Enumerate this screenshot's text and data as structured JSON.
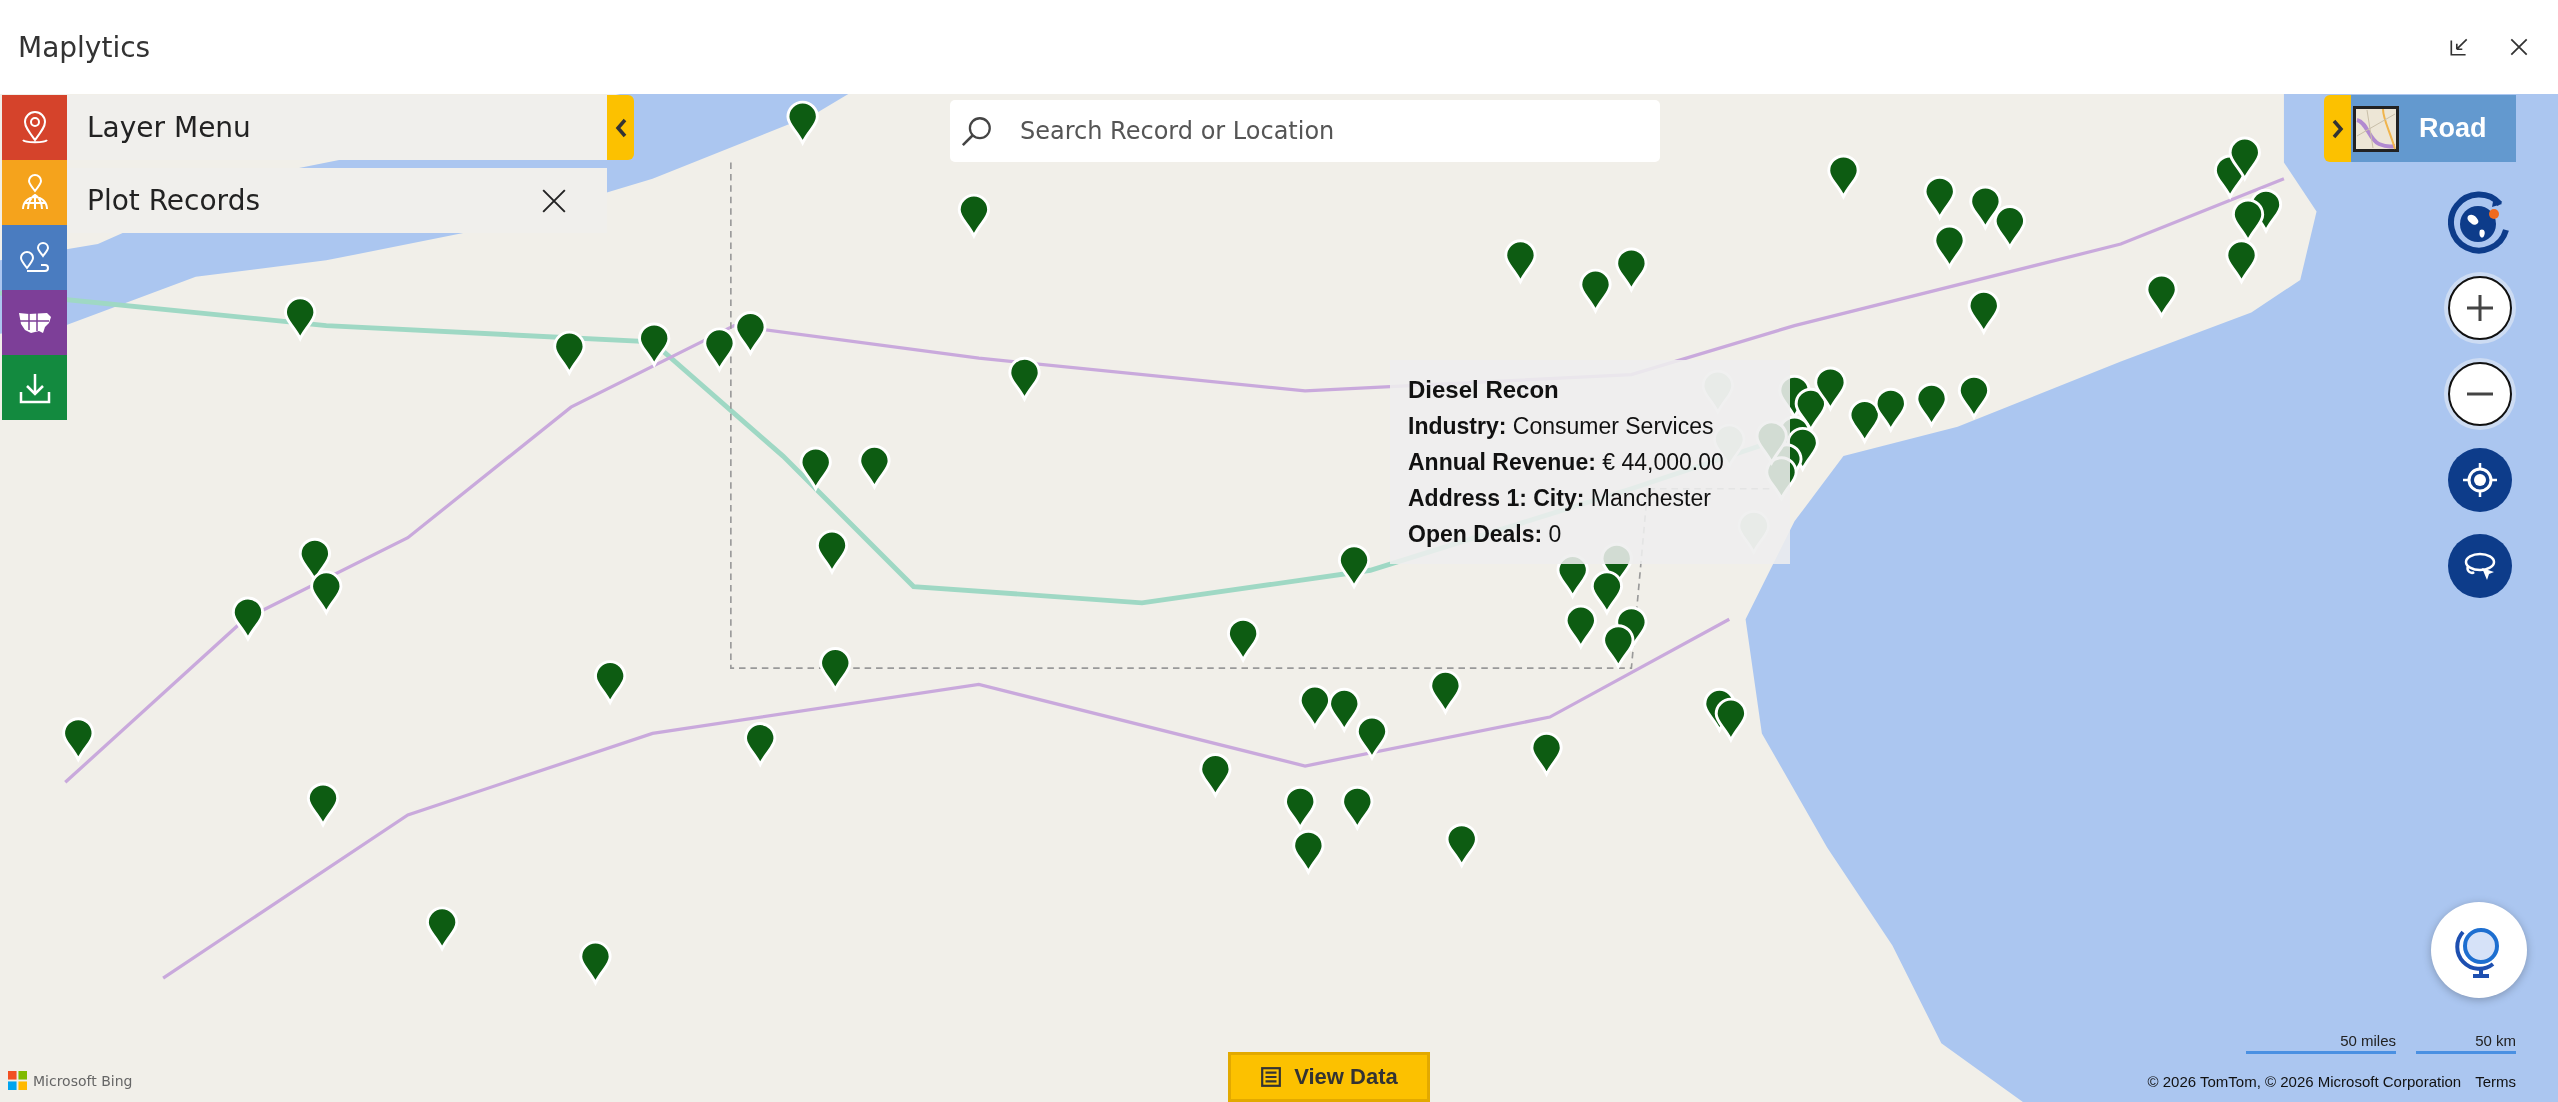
{
  "window": {
    "title": "Maplytics"
  },
  "side_menu": {
    "items": [
      {
        "kind": "layer",
        "color": "#d5432b"
      },
      {
        "kind": "plot",
        "color": "#f5a31c"
      },
      {
        "kind": "route",
        "color": "#4a7cc0"
      },
      {
        "kind": "territory",
        "color": "#7d3f98"
      },
      {
        "kind": "download",
        "color": "#138a3f"
      }
    ]
  },
  "panels": [
    {
      "label": "Layer Menu",
      "kind": "collapse"
    },
    {
      "label": "Plot Records",
      "kind": "close"
    }
  ],
  "search": {
    "placeholder": "Search Record or Location"
  },
  "map_style": {
    "label": "Road"
  },
  "tooltip": {
    "title": "Diesel Recon",
    "fields": [
      {
        "label": "Industry:",
        "value": "Consumer Services"
      },
      {
        "label": "Annual Revenue:",
        "value": "€ 44,000.00"
      },
      {
        "label": "Address 1: City:",
        "value": "Manchester"
      },
      {
        "label": "Open Deals:",
        "value": "0"
      }
    ]
  },
  "scale": [
    "50 miles",
    "50 km"
  ],
  "attribution": {
    "text": "© 2026 TomTom, © 2026 Microsoft Corporation",
    "link": "Terms"
  },
  "logo": "Microsoft Bing",
  "view_data": {
    "label": "View Data"
  }
}
